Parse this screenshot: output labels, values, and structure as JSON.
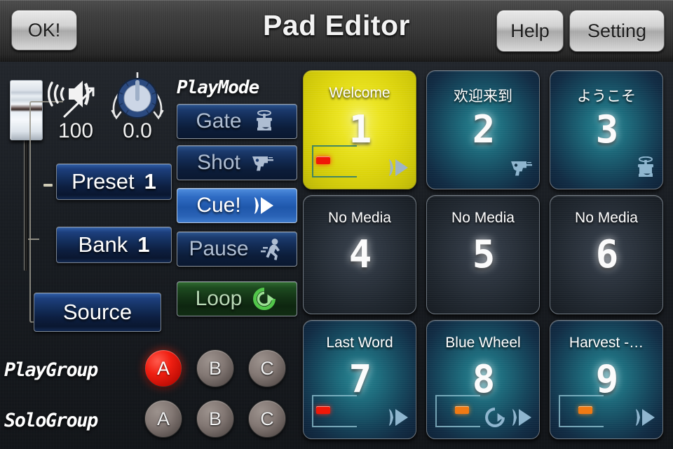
{
  "app": {
    "title": "Pad Editor",
    "accent_yellow": "#ebe420",
    "accent_teal": "#1d6b7c",
    "accent_red": "#f01f12",
    "accent_blue": "#2f6cc4",
    "accent_green": "#1d4a20"
  },
  "topbar": {
    "ok_label": "OK!",
    "help_label": "Help",
    "setting_label": "Setting"
  },
  "controls": {
    "volume_value": "100",
    "knob_value": "0.0",
    "speaker_icon": "speaker-volume-up-icon",
    "knob_icon": "rotary-knob-icon",
    "fader_icon": "vertical-fader-icon",
    "preset_label": "Preset",
    "preset_value": "1",
    "bank_label": "Bank",
    "bank_value": "1",
    "source_label": "Source"
  },
  "playmode": {
    "heading": "PlayMode",
    "buttons": [
      {
        "label": "Gate",
        "icon": "gate-stamp-icon",
        "state": "off"
      },
      {
        "label": "Shot",
        "icon": "pistol-icon",
        "state": "off"
      },
      {
        "label": "Cue!",
        "icon": "cue-play-icon",
        "state": "on"
      },
      {
        "label": "Pause",
        "icon": "running-man-icon",
        "state": "off"
      },
      {
        "label": "Loop",
        "icon": "loop-arrow-icon",
        "state": "loop"
      }
    ]
  },
  "groups": {
    "play_label": "PlayGroup",
    "solo_label": "SoloGroup",
    "play_buttons": [
      {
        "label": "A",
        "active": true
      },
      {
        "label": "B",
        "active": false
      },
      {
        "label": "C",
        "active": false
      }
    ],
    "solo_buttons": [
      {
        "label": "A",
        "active": false
      },
      {
        "label": "B",
        "active": false
      },
      {
        "label": "C",
        "active": false
      }
    ]
  },
  "pads": [
    {
      "number": "1",
      "title": "Welcome",
      "state": "selected",
      "led": "red",
      "icons": [
        "cue-play-icon"
      ]
    },
    {
      "number": "2",
      "title": "欢迎来到",
      "state": "media",
      "led": null,
      "icons": [
        "pistol-icon"
      ]
    },
    {
      "number": "3",
      "title": "ようこそ",
      "state": "media",
      "led": null,
      "icons": [
        "gate-stamp-icon"
      ]
    },
    {
      "number": "4",
      "title": "No Media",
      "state": "empty",
      "led": null,
      "icons": []
    },
    {
      "number": "5",
      "title": "No Media",
      "state": "empty",
      "led": null,
      "icons": []
    },
    {
      "number": "6",
      "title": "No Media",
      "state": "empty",
      "led": null,
      "icons": []
    },
    {
      "number": "7",
      "title": "Last Word",
      "state": "media",
      "led": "red",
      "icons": [
        "cue-play-icon"
      ]
    },
    {
      "number": "8",
      "title": "Blue Wheel",
      "state": "media",
      "led": "orange",
      "icons": [
        "loop-arrow-icon",
        "cue-play-icon"
      ]
    },
    {
      "number": "9",
      "title": "Harvest -…",
      "state": "media",
      "led": "orange",
      "icons": [
        "cue-play-icon"
      ]
    }
  ]
}
